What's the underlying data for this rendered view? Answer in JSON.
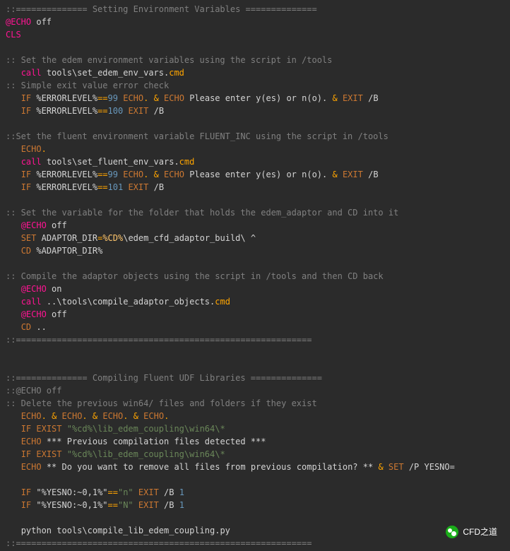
{
  "lines": [
    {
      "t": "comment",
      "v": "::============== Setting Environment Variables =============="
    },
    {
      "t": "echo_off",
      "pre": "@"
    },
    {
      "t": "cls"
    },
    {
      "t": "blank"
    },
    {
      "t": "comment",
      "v": ":: Set the edem environment variables using the script in /tools"
    },
    {
      "t": "call",
      "indent": "   ",
      "path": "tools\\set_edem_env_vars.",
      "ext": "cmd"
    },
    {
      "t": "comment",
      "v": ":: Simple exit value error check"
    },
    {
      "t": "if_err",
      "indent": "   ",
      "n": "99"
    },
    {
      "t": "if_err_exit",
      "indent": "   ",
      "n": "100"
    },
    {
      "t": "blank"
    },
    {
      "t": "comment",
      "v": "::Set the fluent environment variable FLUENT_INC using the script in /tools"
    },
    {
      "t": "echo_dot",
      "indent": "   "
    },
    {
      "t": "call",
      "indent": "   ",
      "path": "tools\\set_fluent_env_vars.",
      "ext": "cmd"
    },
    {
      "t": "if_err",
      "indent": "   ",
      "n": "99"
    },
    {
      "t": "if_err_exit",
      "indent": "   ",
      "n": "101"
    },
    {
      "t": "blank"
    },
    {
      "t": "comment",
      "v": ":: Set the variable for the folder that holds the edem_adaptor and CD into it"
    },
    {
      "t": "echo_off",
      "indent": "   ",
      "pre": "@"
    },
    {
      "t": "set_adaptor",
      "indent": "   "
    },
    {
      "t": "cd",
      "indent": "   ",
      "v": "%ADAPTOR_DIR%"
    },
    {
      "t": "blank"
    },
    {
      "t": "comment",
      "v": ":: Compile the adaptor objects using the script in /tools and then CD back"
    },
    {
      "t": "echo_on",
      "indent": "   ",
      "pre": "@"
    },
    {
      "t": "call",
      "indent": "   ",
      "path": "..\\tools\\compile_adaptor_objects.",
      "ext": "cmd"
    },
    {
      "t": "echo_off",
      "indent": "   ",
      "pre": "@"
    },
    {
      "t": "cd",
      "indent": "   ",
      "v": ".."
    },
    {
      "t": "comment",
      "v": "::=========================================================="
    },
    {
      "t": "blank"
    },
    {
      "t": "blank"
    },
    {
      "t": "comment",
      "v": "::============== Compiling Fluent UDF Libraries =============="
    },
    {
      "t": "comment",
      "v": "::@ECHO off"
    },
    {
      "t": "comment",
      "v": ":: Delete the previous win64/ files and folders if they exist"
    },
    {
      "t": "echo4",
      "indent": "   "
    },
    {
      "t": "if_exist",
      "indent": "   "
    },
    {
      "t": "echo_txt",
      "indent": "   ",
      "v": "*** Previous compilation files detected ***"
    },
    {
      "t": "if_exist",
      "indent": "   "
    },
    {
      "t": "echo_prompt",
      "indent": "   ",
      "v": "** Do you want to remove all files from previous compilation? ** ",
      "tail": "/P YESNO="
    },
    {
      "t": "blank"
    },
    {
      "t": "if_yesno",
      "indent": "   ",
      "c": "n"
    },
    {
      "t": "if_yesno",
      "indent": "   ",
      "c": "N"
    },
    {
      "t": "blank"
    },
    {
      "t": "raw",
      "indent": "   ",
      "v": "python tools\\compile_lib_edem_coupling.py"
    },
    {
      "t": "comment",
      "v": "::=========================================================="
    }
  ],
  "strings": {
    "echo": "ECHO",
    "off": "off",
    "on": "on",
    "cls": "CLS",
    "call": "call",
    "cmd": "cmd",
    "IF": "IF",
    "ERRORLEVEL": "%ERRORLEVEL%",
    "eq": "==",
    "dot": ".",
    "amp": "& ",
    "amp2": "&",
    "please": "Please enter y(es) or n(o).",
    "EXIT": "EXIT",
    "slashB": "/B",
    "SET": "SET",
    "ADAPTOR_DIR": "ADAPTOR_DIR",
    "assign": "=",
    "cdvar": "%CD%",
    "adaptor_path": "\\edem_cfd_adaptor_build\\ ^",
    "CD": "CD",
    "EXIST": "EXIST",
    "exist_str": "\"%cd%\\lib_edem_coupling\\win64\\*",
    "YESNO": "\"%YESNO:~0,1%\"",
    "one": "1"
  },
  "watermark": "CFD之道"
}
